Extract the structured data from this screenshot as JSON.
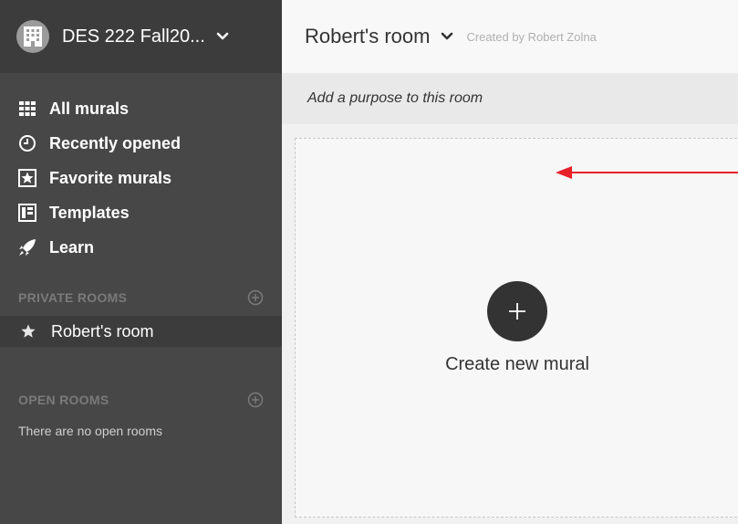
{
  "workspace": {
    "name": "DES 222 Fall20..."
  },
  "nav": {
    "items": [
      {
        "label": "All murals",
        "icon": "grid-icon"
      },
      {
        "label": "Recently opened",
        "icon": "clock-icon"
      },
      {
        "label": "Favorite murals",
        "icon": "star-box-icon"
      },
      {
        "label": "Templates",
        "icon": "template-icon"
      },
      {
        "label": "Learn",
        "icon": "rocket-icon"
      }
    ]
  },
  "private_rooms": {
    "heading": "PRIVATE ROOMS",
    "rooms": [
      {
        "label": "Robert's room",
        "icon": "star-icon"
      }
    ]
  },
  "open_rooms": {
    "heading": "OPEN ROOMS",
    "empty_text": "There are no open rooms"
  },
  "room": {
    "title": "Robert's room",
    "created_by": "Created by Robert Zolna",
    "purpose_placeholder": "Add a purpose to this room"
  },
  "create": {
    "label": "Create new mural"
  },
  "colors": {
    "sidebar_bg": "#474747",
    "sidebar_header_bg": "#3c3c3c",
    "selected_room_bg": "#3c3c3c",
    "create_button": "#333333",
    "annotation_arrow": "#e8202a"
  }
}
